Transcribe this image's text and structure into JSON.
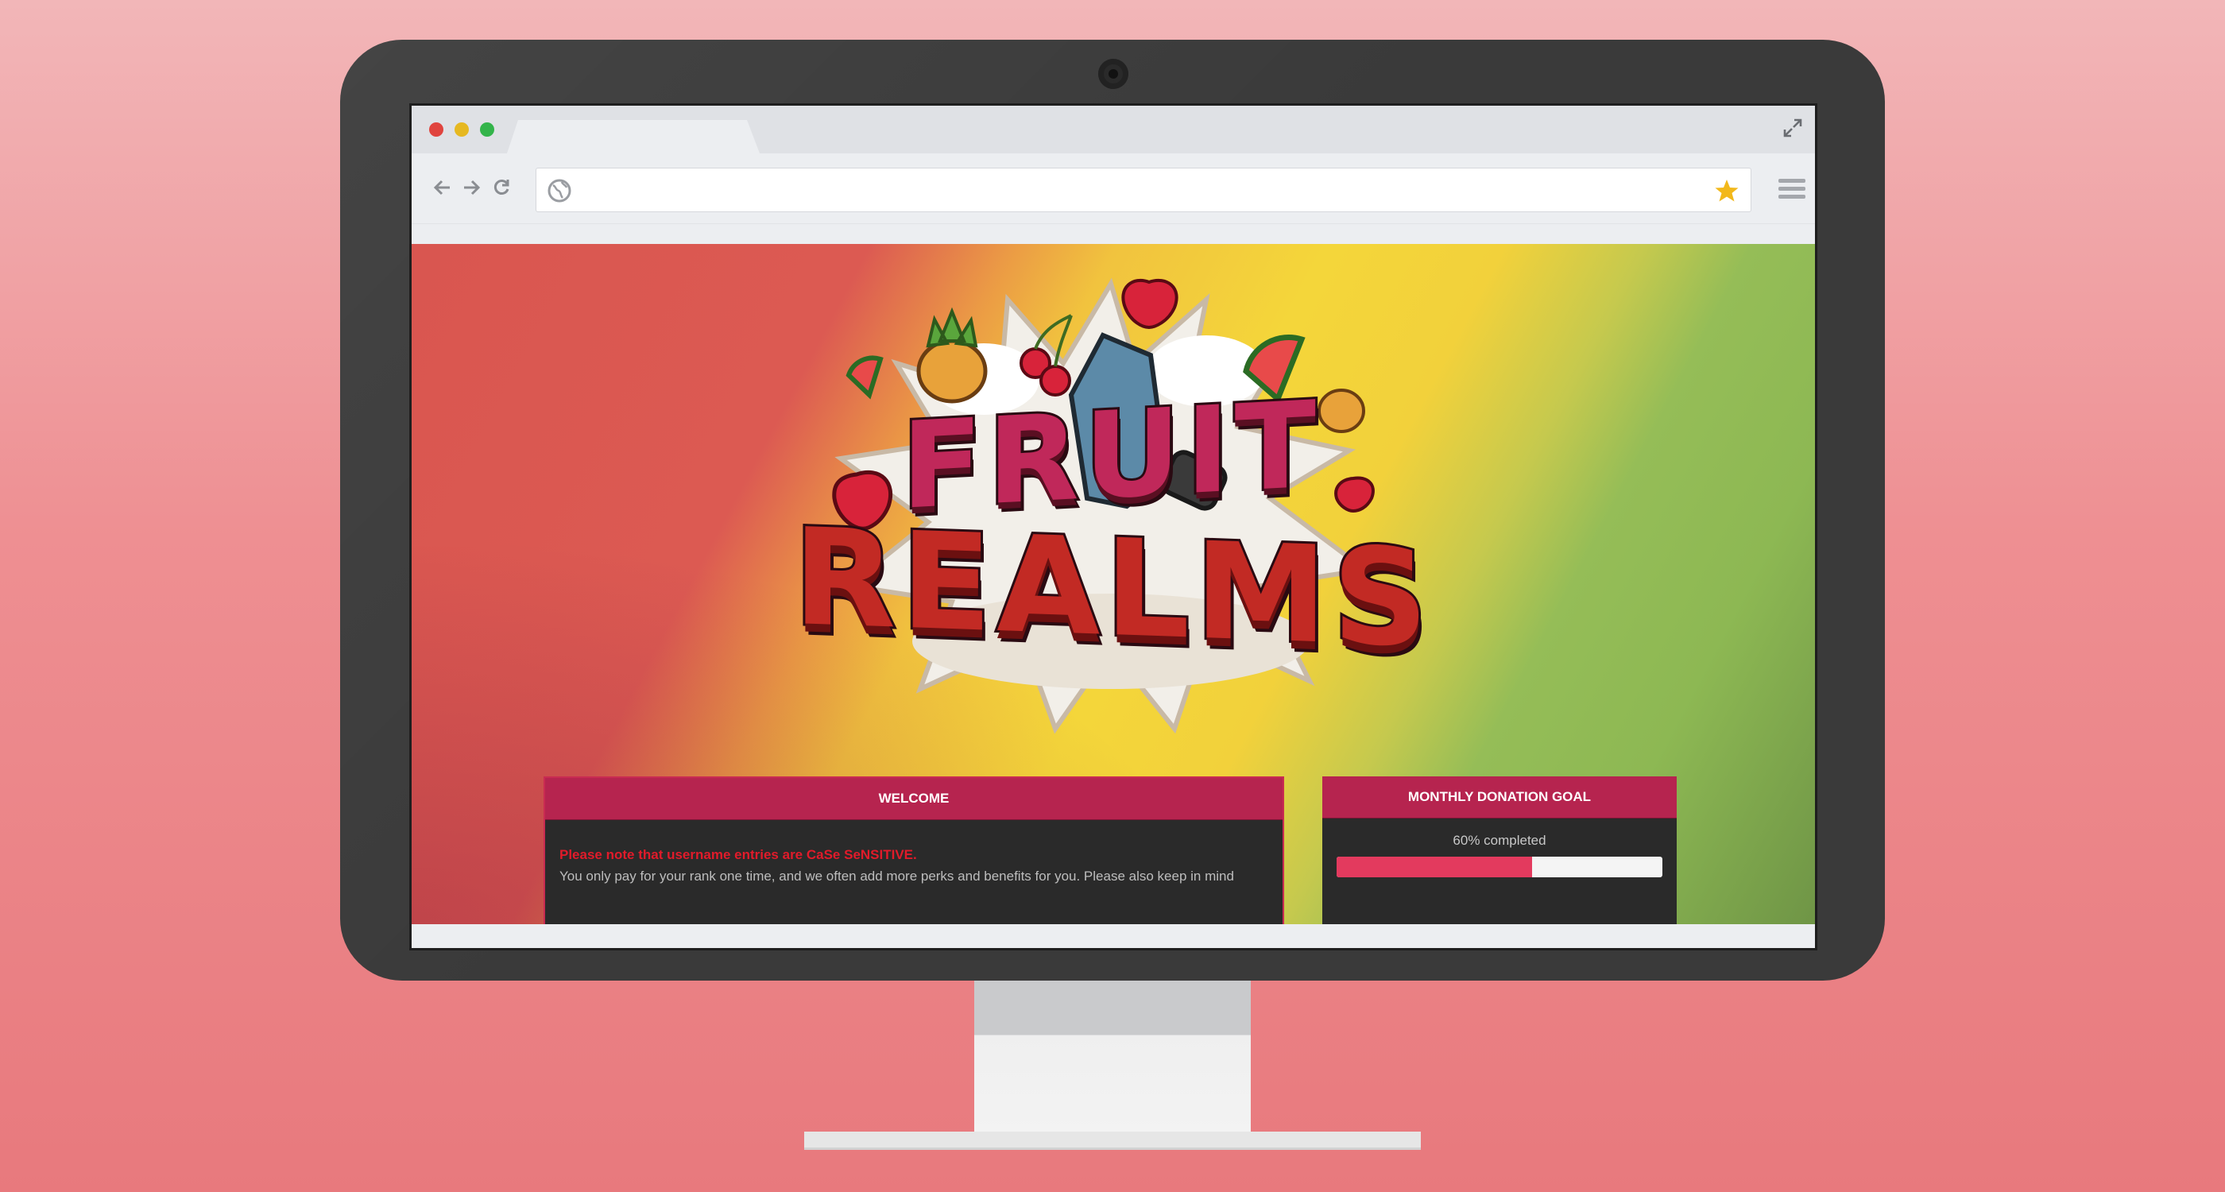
{
  "browser": {
    "url": "",
    "window_controls": [
      "close",
      "minimize",
      "maximize"
    ],
    "icons": {
      "back": "arrow-left-icon",
      "forward": "arrow-right-icon",
      "reload": "reload-icon",
      "site": "globe-icon",
      "bookmark": "star-icon",
      "menu": "hamburger-menu-icon",
      "expand": "expand-icon"
    }
  },
  "page": {
    "logo": {
      "line1": "FRUIT",
      "line2": "REALMS"
    },
    "welcome": {
      "title": "WELCOME",
      "note": "Please note that username entries are CaSe SeNSITIVE.",
      "body": "You only pay for your rank one time, and we often add more perks and benefits for you. Please also keep in mind"
    },
    "donation": {
      "title": "MONTHLY DONATION GOAL",
      "status": "60% completed",
      "progress": 0.6
    }
  },
  "colors": {
    "accent": "#b6244f",
    "progress": "#e33a5e",
    "warning_text": "#e11b2a",
    "panel_bg": "#2a2a2a"
  }
}
